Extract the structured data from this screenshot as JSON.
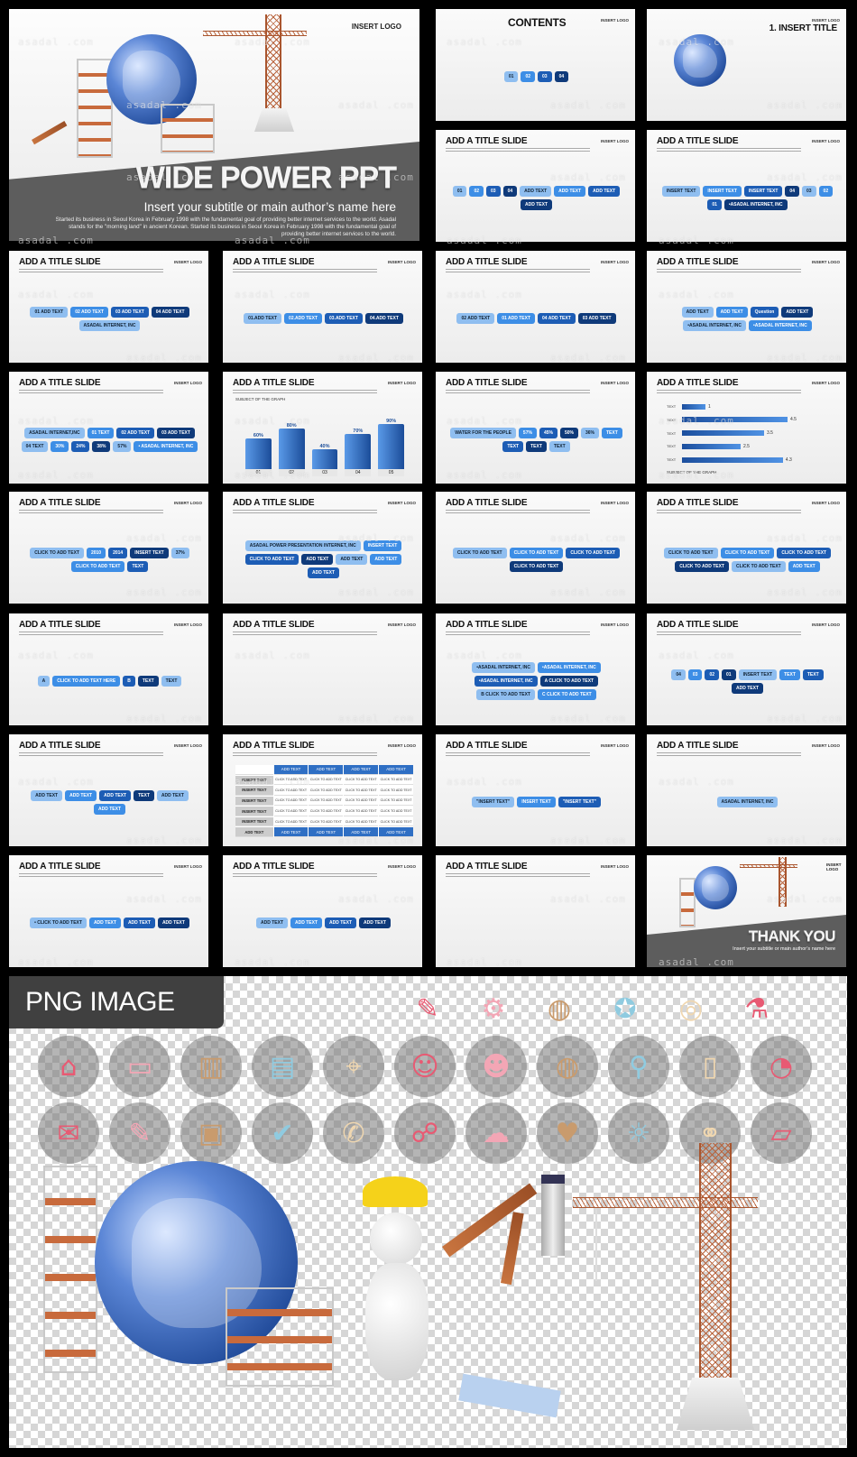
{
  "watermark": "asadal .com",
  "cover": {
    "logo": "INSERT LOGO",
    "title": "WIDE POWER PPT",
    "subtitle": "Insert your subtitle or main author’s name here",
    "body": "Started its business in Seoul Korea in February 1998 with the fundamental goal of providing better internet services to the world. Asadal stands for the \"morning land\" in ancient Korean. Started its business in Seoul Korea in February 1998 with the fundamental goal of providing better internet services to the world."
  },
  "slides": [
    {
      "title": "CONTENTS",
      "logo": "INSERT LOGO",
      "labels": [
        "01",
        "02",
        "03",
        "04"
      ]
    },
    {
      "title": "1. INSERT TITLE",
      "logo": "INSERT LOGO",
      "labels": []
    },
    {
      "title": "ADD A TITLE SLIDE",
      "logo": "INSERT LOGO",
      "labels": [
        "01",
        "02",
        "03",
        "04",
        "ADD TEXT",
        "ADD TEXT",
        "ADD TEXT",
        "ADD TEXT"
      ]
    },
    {
      "title": "ADD A TITLE SLIDE",
      "logo": "INSERT LOGO",
      "labels": [
        "INSERT TEXT",
        "INSERT TEXT",
        "INSERT TEXT",
        "04",
        "03",
        "02",
        "01",
        "•ASADAL INTERNET, INC"
      ]
    },
    {
      "title": "ADD A TITLE SLIDE",
      "logo": "INSERT LOGO",
      "labels": [
        "01 ADD TEXT",
        "02 ADD TEXT",
        "03 ADD TEXT",
        "04 ADD TEXT",
        "ASADAL INTERNET, INC"
      ]
    },
    {
      "title": "ADD A TITLE SLIDE",
      "logo": "INSERT LOGO",
      "labels": [
        "01.ADD TEXT",
        "02.ADD TEXT",
        "03.ADD TEXT",
        "04.ADD TEXT"
      ]
    },
    {
      "title": "ADD A TITLE SLIDE",
      "logo": "INSERT LOGO",
      "labels": [
        "02 ADD TEXT",
        "01 ADD TEXT",
        "04 ADD TEXT",
        "03 ADD TEXT"
      ]
    },
    {
      "title": "ADD A TITLE SLIDE",
      "logo": "INSERT LOGO",
      "labels": [
        "ADD TEXT",
        "ADD TEXT",
        "Question",
        "ADD TEXT",
        "•ASADAL INTERNET, INC",
        "•ASADAL INTERNET, INC"
      ]
    },
    {
      "title": "ADD A TITLE SLIDE",
      "logo": "INSERT LOGO",
      "labels": [
        "ASADAL INTERNET,INC",
        "01 TEXT",
        "02 ADD TEXT",
        "03 ADD TEXT",
        "04 TEXT",
        "30%",
        "24%",
        "38%",
        "57%",
        "• ASADAL INTERNET, INC"
      ]
    },
    {
      "title": "ADD A TITLE SLIDE",
      "logo": "INSERT LOGO",
      "kind": "vbar",
      "subject": "SUBJECT OF THE GRAPH",
      "bars": [
        {
          "num": "01",
          "label": "ADD TEXT",
          "value": 60
        },
        {
          "num": "02",
          "label": "ADD TEXT",
          "value": 80
        },
        {
          "num": "03",
          "label": "ADD TEXT",
          "value": 40
        },
        {
          "num": "04",
          "label": "ADD TEXT",
          "value": 70
        },
        {
          "num": "05",
          "label": "ADD TEXT",
          "value": 90
        }
      ]
    },
    {
      "title": "ADD A TITLE SLIDE",
      "logo": "INSERT LOGO",
      "labels": [
        "WATER FOR THE PEOPLE",
        "57%",
        "45%",
        "50%",
        "36%",
        "TEXT",
        "TEXT",
        "TEXT",
        "TEXT"
      ]
    },
    {
      "title": "ADD A TITLE SLIDE",
      "logo": "INSERT LOGO",
      "kind": "hbar",
      "subject": "SUBJECT OF THE GRAPH",
      "hbars": [
        {
          "label": "TEXT",
          "value": 1
        },
        {
          "label": "TEXT",
          "value": 4.5
        },
        {
          "label": "TEXT",
          "value": 3.5
        },
        {
          "label": "TEXT",
          "value": 2.5
        },
        {
          "label": "TEXT",
          "value": 4.3
        }
      ]
    },
    {
      "title": "ADD A TITLE SLIDE",
      "logo": "INSERT LOGO",
      "labels": [
        "CLICK TO ADD TEXT",
        "2010",
        "2014",
        "INSERT TEXT",
        "37%",
        "CLICK TO ADD TEXT",
        "TEXT"
      ]
    },
    {
      "title": "ADD A TITLE SLIDE",
      "logo": "INSERT LOGO",
      "labels": [
        "ASADAL POWER PRESENTATION INTERNET, INC",
        "INSERT TEXT",
        "CLICK TO ADD TEXT",
        "ADD TEXT",
        "ADD TEXT",
        "ADD TEXT",
        "ADD TEXT"
      ]
    },
    {
      "title": "ADD A TITLE SLIDE",
      "logo": "INSERT LOGO",
      "labels": [
        "CLICK TO ADD TEXT",
        "CLICK TO ADD TEXT",
        "CLICK TO ADD TEXT",
        "CLICK TO ADD TEXT"
      ]
    },
    {
      "title": "ADD A TITLE SLIDE",
      "logo": "INSERT LOGO",
      "labels": [
        "CLICK TO ADD TEXT",
        "CLICK TO ADD TEXT",
        "CLICK TO ADD TEXT",
        "CLICK TO ADD TEXT",
        "CLICK TO ADD TEXT",
        "ADD TEXT"
      ]
    },
    {
      "title": "ADD A TITLE SLIDE",
      "logo": "INSERT LOGO",
      "labels": [
        "A",
        "CLICK TO ADD TEXT HERE",
        "B",
        "TEXT",
        "TEXT"
      ]
    },
    {
      "title": "ADD A TITLE SLIDE",
      "logo": "INSERT LOGO",
      "labels": []
    },
    {
      "title": "ADD A TITLE SLIDE",
      "logo": "INSERT LOGO",
      "labels": [
        "•ASADAL INTERNET, INC",
        "•ASADAL INTERNET, INC",
        "•ASADAL INTERNET, INC",
        "A CLICK TO ADD TEXT",
        "B CLICK TO ADD TEXT",
        "C CLICK TO ADD TEXT"
      ]
    },
    {
      "title": "ADD A TITLE SLIDE",
      "logo": "INSERT LOGO",
      "labels": [
        "04",
        "03",
        "02",
        "01",
        "INSERT TEXT",
        "TEXT",
        "TEXT",
        "ADD TEXT"
      ]
    },
    {
      "title": "ADD A TITLE SLIDE",
      "logo": "INSERT LOGO",
      "labels": [
        "ADD TEXT",
        "ADD TEXT",
        "ADD TEXT",
        "TEXT",
        "ADD TEXT",
        "ADD TEXT"
      ]
    },
    {
      "title": "ADD A TITLE SLIDE",
      "logo": "INSERT LOGO",
      "kind": "table",
      "table": {
        "header": [
          "ADD TEXT",
          "ADD TEXT",
          "ADD TEXT",
          "ADD TEXT"
        ],
        "row_label": "INSERT TEXT",
        "cell": "CLICK TO ADD TEXT",
        "rows": 5,
        "footer_label": "ADD TEXT",
        "footer": [
          "ADD TEXT",
          "ADD TEXT",
          "ADD TEXT",
          "ADD TEXT"
        ]
      }
    },
    {
      "title": "ADD A TITLE SLIDE",
      "logo": "INSERT LOGO",
      "labels": [
        "\"INSERT TEXT\"",
        "INSERT TEXT",
        "\"INSERT TEXT\""
      ]
    },
    {
      "title": "ADD A TITLE SLIDE",
      "logo": "INSERT LOGO",
      "labels": [
        "ASADAL INTERNET, INC"
      ]
    },
    {
      "title": "ADD A TITLE SLIDE",
      "logo": "INSERT LOGO",
      "labels": [
        "• CLICK TO ADD TEXT",
        "ADD TEXT",
        "ADD TEXT",
        "ADD TEXT"
      ]
    },
    {
      "title": "ADD A TITLE SLIDE",
      "logo": "INSERT LOGO",
      "labels": [
        "ADD TEXT",
        "ADD TEXT",
        "ADD TEXT",
        "ADD TEXT"
      ]
    },
    {
      "title": "ADD A TITLE SLIDE",
      "logo": "INSERT LOGO",
      "labels": []
    }
  ],
  "thankyou": {
    "logo": "INSERT LOGO",
    "title": "THANK YOU",
    "subtitle": "Insert your subtitle or main author’s name here"
  },
  "png": {
    "label": "PNG IMAGE",
    "icons_row1": [
      "notebook-search-icon",
      "browser-gear-icon",
      "globe-email-icon",
      "award-ribbon-icon",
      "target-arrow-icon",
      "test-tubes-icon"
    ],
    "icons_row2": [
      "house-icon",
      "monitor-icon",
      "presentation-chart-icon",
      "newspaper-icon",
      "map-pin-icon",
      "businessman-icon",
      "support-woman-icon",
      "globe-email-icon",
      "microphone-icon",
      "open-book-icon",
      "pie-chart-icon"
    ],
    "icons_row3": [
      "envelope-icon",
      "notebook-search-icon",
      "gift-icon",
      "clipboard-check-icon",
      "chat-bubble-icon",
      "network-icon",
      "cloud-download-icon",
      "heart-plant-icon",
      "lightbulb-icon",
      "translate-link-icon",
      "folder-chart-icon"
    ]
  },
  "colors": {
    "accent": "#2f6fc4",
    "dark_blue": "#0f3a7a",
    "band_gray": "#5d5d5d",
    "crane": "#b9653e",
    "helmet": "#f5d21a"
  }
}
